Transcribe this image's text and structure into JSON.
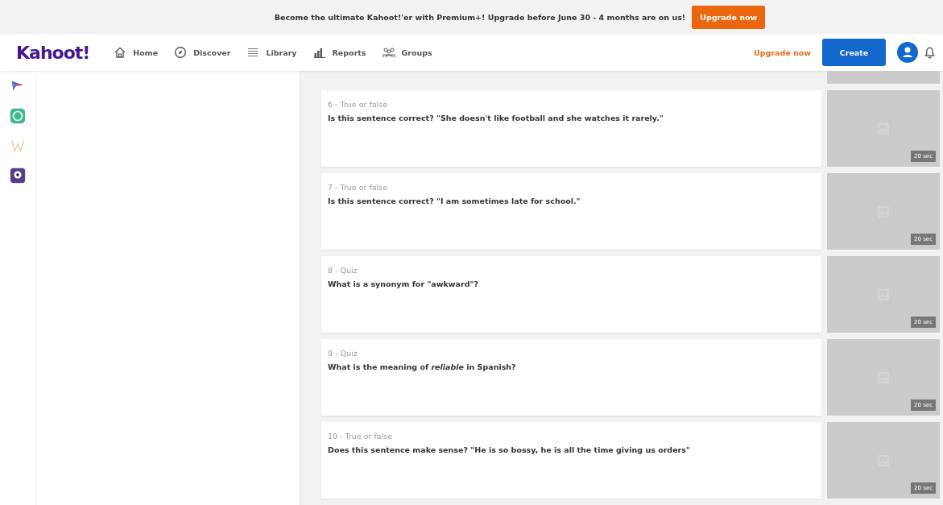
{
  "banner": {
    "text": "Become the ultimate Kahoot!'er with Premium+! Upgrade before June 30 - 4 months are on us!",
    "button": "Upgrade now"
  },
  "nav": {
    "logo": "Kahoot!",
    "items": [
      {
        "kind": "home",
        "label": "Home"
      },
      {
        "kind": "discover",
        "label": "Discover"
      },
      {
        "kind": "library",
        "label": "Library"
      },
      {
        "kind": "reports",
        "label": "Reports"
      },
      {
        "kind": "groups",
        "label": "Groups"
      }
    ],
    "upgrade_link": "Upgrade now",
    "create_button": "Create"
  },
  "app_icons": [
    {
      "kind": "arrow"
    },
    {
      "kind": "chat"
    },
    {
      "kind": "w"
    },
    {
      "kind": "camera"
    }
  ],
  "questions": [
    {
      "kind": "clipped"
    },
    {
      "kind": "question",
      "header": "6 - True or false",
      "text": "Is this sentence correct? \"She doesn't like football and she watches it rarely.\"",
      "time": "20 sec"
    },
    {
      "kind": "question",
      "header": "7 - True or false",
      "text": "Is this sentence correct? \"I am sometimes late for school.\"",
      "time": "20 sec"
    },
    {
      "kind": "question",
      "header": "8 - Quiz",
      "text": "What is a synonym for \"awkward\"?",
      "time": "20 sec"
    },
    {
      "kind": "question",
      "header": "9 - Quiz",
      "text": "What is the meaning of *reliable* in Spanish?",
      "time": "20 sec"
    },
    {
      "kind": "question",
      "header": "10 - True or false",
      "text": "Does this sentence make sense? \"He is so bossy, he is all the time giving us orders\"",
      "time": "20 sec"
    }
  ]
}
